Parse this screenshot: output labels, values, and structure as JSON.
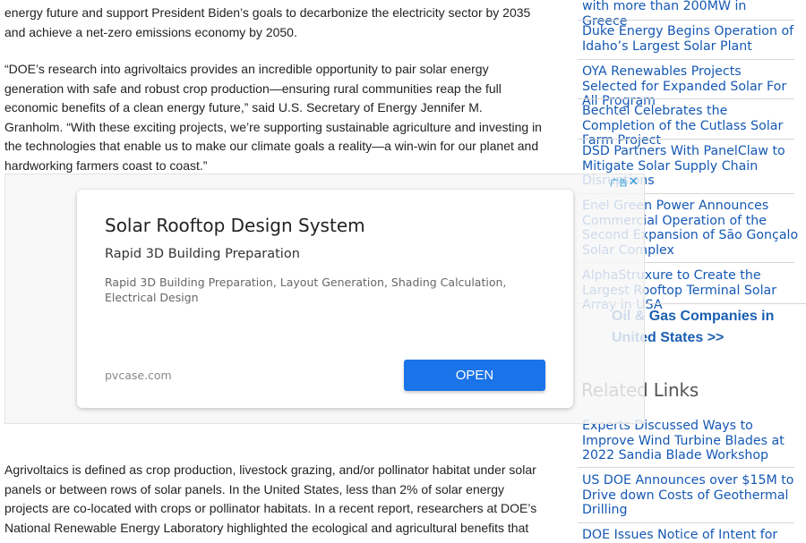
{
  "article": {
    "p1": "energy future and support President Biden’s goals to decarbonize the electricity sector by 2035 and achieve a net-zero emissions economy by 2050.",
    "p2": "“DOE’s research into agrivoltaics provides an incredible opportunity to pair solar energy generation with safe and robust crop production—ensuring rural communities reap the full economic benefits of a clean energy future,” said U.S. Secretary of Energy Jennifer M. Granholm. “With these exciting projects, we’re supporting sustainable agriculture and investing in the technologies that enable us to make our climate goals a reality—a win-win for our planet and hardworking farmers coast to coast.”",
    "p3": "Agrivoltaics is defined as crop production, livestock grazing, and/or pollinator habitat under solar panels or between rows of solar panels. In the United States, less than 2% of solar energy projects are co-located with crops or pollinator habitats. In a recent report, researchers at DOE’s National Renewable Energy Laboratory highlighted the ecological and agricultural benefits that"
  },
  "sidebar": {
    "news_links": [
      "with more than 200MW in Greece",
      "Duke Energy Begins Operation of Idaho’s Largest Solar Plant",
      "OYA Renewables Projects Selected for Expanded Solar For All Program",
      "Bechtel Celebrates the Completion of the Cutlass Solar Farm Project",
      "DSD Partners With PanelClaw to Mitigate Solar Supply Chain Disruptions",
      "Enel Green Power Announces Commercial Operation of the Second Expansion of São Gonçalo Solar Complex",
      "AlphaStruxure to Create the Largest Rooftop Terminal Solar Array in USA"
    ],
    "more_link": "Oil & Gas Companies in United States >>",
    "related_title": "Related Links",
    "related_links": [
      "Experts Discussed Ways to Improve Wind Turbine Blades at 2022 Sandia Blade Workshop",
      "US DOE Announces over $15M to Drive down Costs of Geothermal Drilling",
      "DOE Issues Notice of Intent for"
    ]
  },
  "ad": {
    "title": "Solar Rooftop Design System",
    "subtitle": "Rapid 3D Building Preparation",
    "description": "Rapid 3D Building Preparation, Layout Generation, Shading Calculation, Electrical Design",
    "domain": "pvcase.com",
    "cta": "OPEN",
    "badge": "广告",
    "close_icon": "✕"
  },
  "colors": {
    "link": "#1558b4",
    "cta_button": "#1a73e8",
    "body_text": "#222222"
  }
}
